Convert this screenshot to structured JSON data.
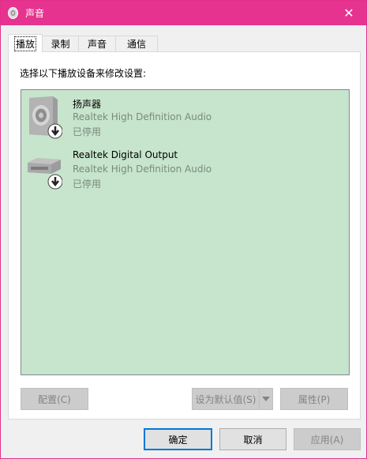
{
  "window": {
    "title": "声音",
    "title_icon": "speaker-icon",
    "close_icon": "close-icon",
    "close_glyph": "✕",
    "accent_color": "#e5338f"
  },
  "tabs": [
    {
      "label": "播放",
      "active": true
    },
    {
      "label": "录制",
      "active": false
    },
    {
      "label": "声音",
      "active": false
    },
    {
      "label": "通信",
      "active": false
    }
  ],
  "panel": {
    "instruction": "选择以下播放设备来修改设置:",
    "list_bg": "#c7e4cc",
    "devices": [
      {
        "name": "扬声器",
        "driver": "Realtek High Definition Audio",
        "status": "已停用",
        "icon": "speaker-device-icon"
      },
      {
        "name": "Realtek Digital Output",
        "driver": "Realtek High Definition Audio",
        "status": "已停用",
        "icon": "digital-output-device-icon"
      }
    ],
    "configure_button": "配置(C)",
    "set_default_button": "设为默认值(S)",
    "properties_button": "属性(P)"
  },
  "footer": {
    "ok_button": "确定",
    "cancel_button": "取消",
    "apply_button": "应用(A)"
  }
}
